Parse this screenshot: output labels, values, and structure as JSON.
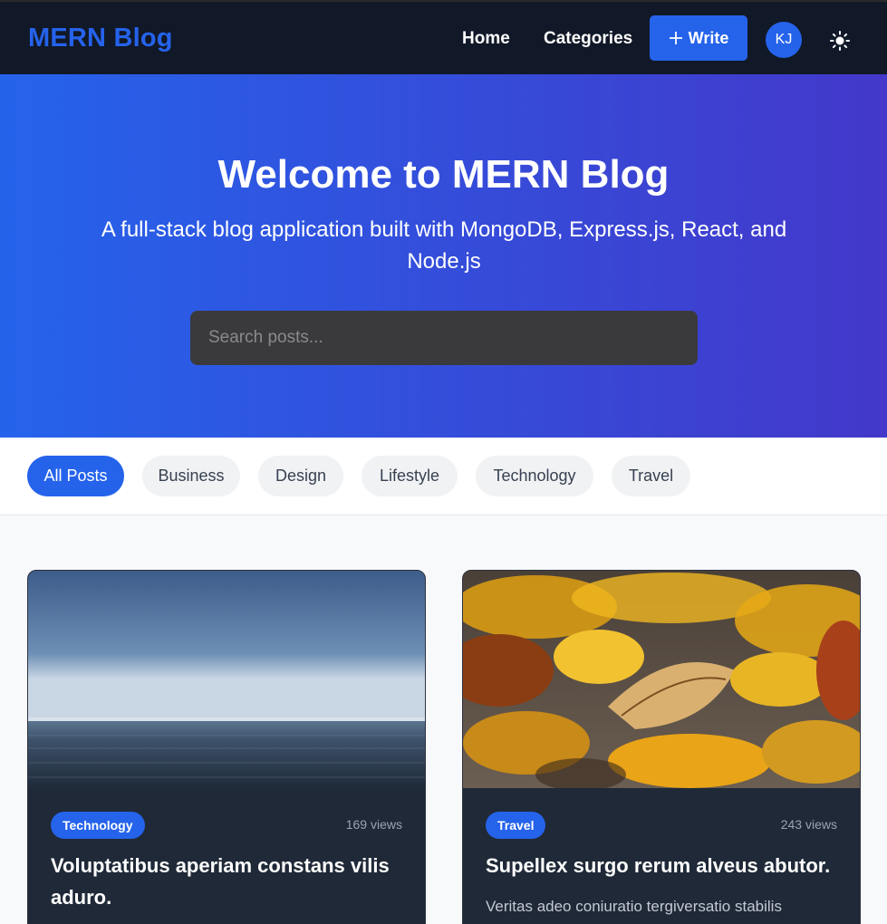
{
  "navbar": {
    "brand": "MERN Blog",
    "links": [
      "Home",
      "Categories"
    ],
    "write_label": "Write",
    "avatar_initials": "KJ",
    "theme_icon": "sun-icon"
  },
  "hero": {
    "title": "Welcome to MERN Blog",
    "subtitle": "A full-stack blog application built with MongoDB, Express.js, React, and Node.js",
    "search_placeholder": "Search posts..."
  },
  "filters": {
    "active": "All Posts",
    "items": [
      "All Posts",
      "Business",
      "Design",
      "Lifestyle",
      "Technology",
      "Travel"
    ]
  },
  "posts": [
    {
      "category": "Technology",
      "views": "169 views",
      "title": "Voluptatibus aperiam constans vilis aduro.",
      "excerpt": "",
      "image": "ocean-horizon-image"
    },
    {
      "category": "Travel",
      "views": "243 views",
      "title": "Supellex surgo rerum alveus abutor.",
      "excerpt": "Veritas adeo coniuratio tergiversatio stabilis",
      "image": "autumn-leaves-image"
    }
  ],
  "colors": {
    "accent": "#2563eb",
    "navbar_bg": "#111827",
    "card_bg": "#1f2937",
    "hero_gradient_start": "#2563eb",
    "hero_gradient_end": "#4338ca"
  }
}
